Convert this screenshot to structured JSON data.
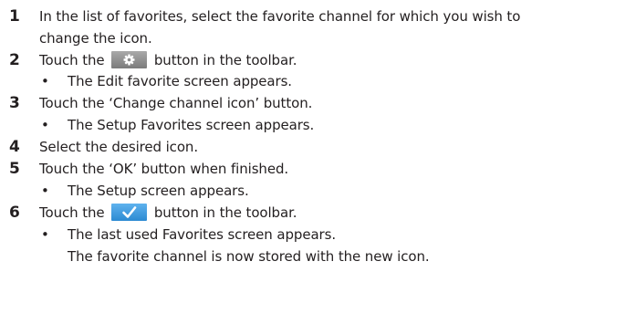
{
  "steps": [
    {
      "number": "1",
      "lines": [
        "In the list of favorites, select the favorite channel for which you wish to",
        "change the icon."
      ]
    },
    {
      "number": "2",
      "before": "Touch the",
      "icon": "gear-icon",
      "after": "button in the toolbar.",
      "bullet": "The Edit favorite screen appears."
    },
    {
      "number": "3",
      "text": "Touch the ‘Change channel icon’ button.",
      "bullet": "The Setup Favorites screen appears."
    },
    {
      "number": "4",
      "text": "Select the desired icon."
    },
    {
      "number": "5",
      "text": "Touch the ‘OK’ button when finished.",
      "bullet": "The Setup screen appears."
    },
    {
      "number": "6",
      "before": "Touch the",
      "icon": "checkmark-icon",
      "after": "button in the toolbar.",
      "bullet": "The last used Favorites screen appears.",
      "continuation": "The favorite channel is now stored with the new icon."
    }
  ],
  "bullet_symbol": "•",
  "colors": {
    "text": "#231f20",
    "gear_button": "#8c8c8c",
    "check_button": "#3b98dd"
  }
}
